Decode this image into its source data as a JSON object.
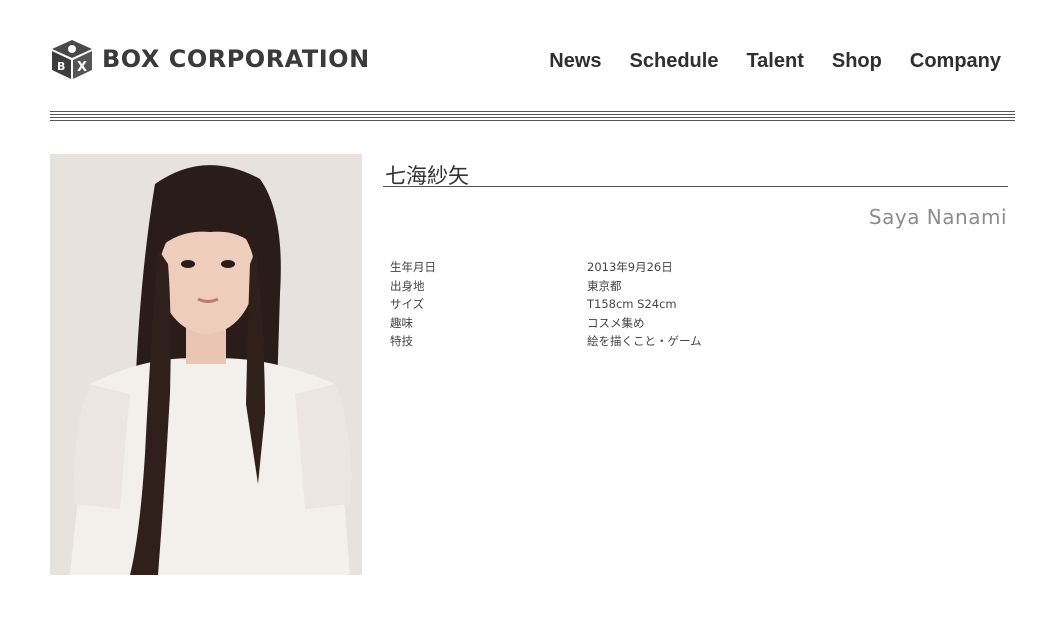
{
  "header": {
    "logo_text": "BOX CORPORATION",
    "logo_icon": "box-logo-icon",
    "nav": [
      "News",
      "Schedule",
      "Talent",
      "Shop",
      "Company"
    ]
  },
  "talent": {
    "name_jp": "七海紗矢",
    "name_en": "Saya Nanami",
    "profile": [
      {
        "label": "生年月日",
        "value": "2013年9月26日"
      },
      {
        "label": "出身地",
        "value": "東京都"
      },
      {
        "label": "サイズ",
        "value": "T158cm S24cm"
      },
      {
        "label": "趣味",
        "value": "コスメ集め"
      },
      {
        "label": "特技",
        "value": "絵を描くこと・ゲーム"
      }
    ]
  },
  "colors": {
    "text": "#333333",
    "name_en": "#8c8c8c",
    "rule": "#555555",
    "photo_bg": "#e7e1dd"
  }
}
